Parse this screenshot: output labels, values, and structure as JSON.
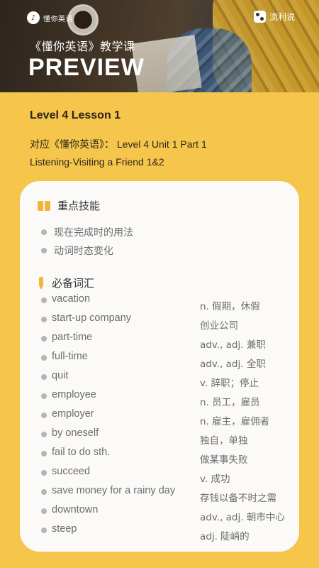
{
  "header": {
    "logo_text": "懂你英语",
    "brand": "流利说",
    "course": "《懂你英语》教学课",
    "title": "PREVIEW"
  },
  "lesson": {
    "title": "Level 4 Lesson 1",
    "mapping": "对应《懂你英语》： Level 4 Unit 1 Part 1",
    "topic": "Listening-Visiting a Friend 1&2"
  },
  "skills": {
    "heading": "重点技能",
    "items": [
      "现在完成时的用法",
      "动词时态变化"
    ]
  },
  "vocabulary": {
    "heading": "必备词汇",
    "items": [
      {
        "word": "vacation",
        "definition": "n. 假期，休假"
      },
      {
        "word": "start-up company",
        "definition": "创业公司"
      },
      {
        "word": "part-time",
        "definition": "adv., adj. 兼职"
      },
      {
        "word": "full-time",
        "definition": "adv., adj. 全职"
      },
      {
        "word": "quit",
        "definition": "v. 辞职；停止"
      },
      {
        "word": "employee",
        "definition": "n. 员工，雇员"
      },
      {
        "word": "employer",
        "definition": "n. 雇主，雇佣者"
      },
      {
        "word": "by oneself",
        "definition": "独自，单独"
      },
      {
        "word": "fail to do sth.",
        "definition": "做某事失败"
      },
      {
        "word": "succeed",
        "definition": "v. 成功"
      },
      {
        "word": "save money for a rainy day",
        "definition": "存钱以备不时之需"
      },
      {
        "word": "downtown",
        "definition": "adv., adj. 朝市中心"
      },
      {
        "word": "steep",
        "definition": "adj. 陡峭的"
      }
    ]
  },
  "icons": {
    "skills": "book-icon",
    "vocabulary": "pen-icon"
  },
  "colors": {
    "background": "#f5c64b",
    "card": "#fbfaf8",
    "accent": "#f0b53a"
  }
}
